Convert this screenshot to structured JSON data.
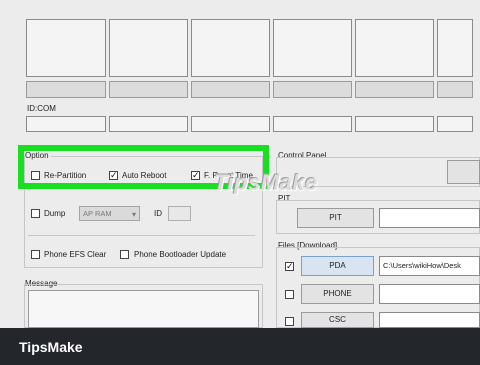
{
  "id_com": {
    "label": "ID:COM"
  },
  "option": {
    "title": "Option",
    "re_partition": {
      "label": "Re-Partition",
      "checked": false
    },
    "auto_reboot": {
      "label": "Auto Reboot",
      "checked": true
    },
    "f_reset_time": {
      "label": "F. Reset Time",
      "checked": true
    },
    "dump": {
      "label": "Dump",
      "checked": false
    },
    "ap_ram": {
      "value": "AP RAM"
    },
    "id_label": "ID",
    "phone_efs_clear": {
      "label": "Phone EFS Clear",
      "checked": false
    },
    "phone_bootloader_update": {
      "label": "Phone Bootloader Update",
      "checked": false
    }
  },
  "message": {
    "title": "Message"
  },
  "control_panel": {
    "title": "Control Panel"
  },
  "pit": {
    "group_title": "PIT",
    "button_label": "PIT"
  },
  "files": {
    "title": "Files [Download]",
    "pda": {
      "button_label": "PDA",
      "checked": true,
      "path": "C:\\Users\\wikiHow\\Desk"
    },
    "phone": {
      "button_label": "PHONE",
      "checked": false
    },
    "csc": {
      "button_label": "CSC",
      "checked": false
    }
  },
  "watermark": {
    "text": "TipsMake"
  },
  "footer": {
    "brand": "TipsMake"
  },
  "colors": {
    "highlight": "#18e020",
    "footer_bg": "#23262b"
  }
}
